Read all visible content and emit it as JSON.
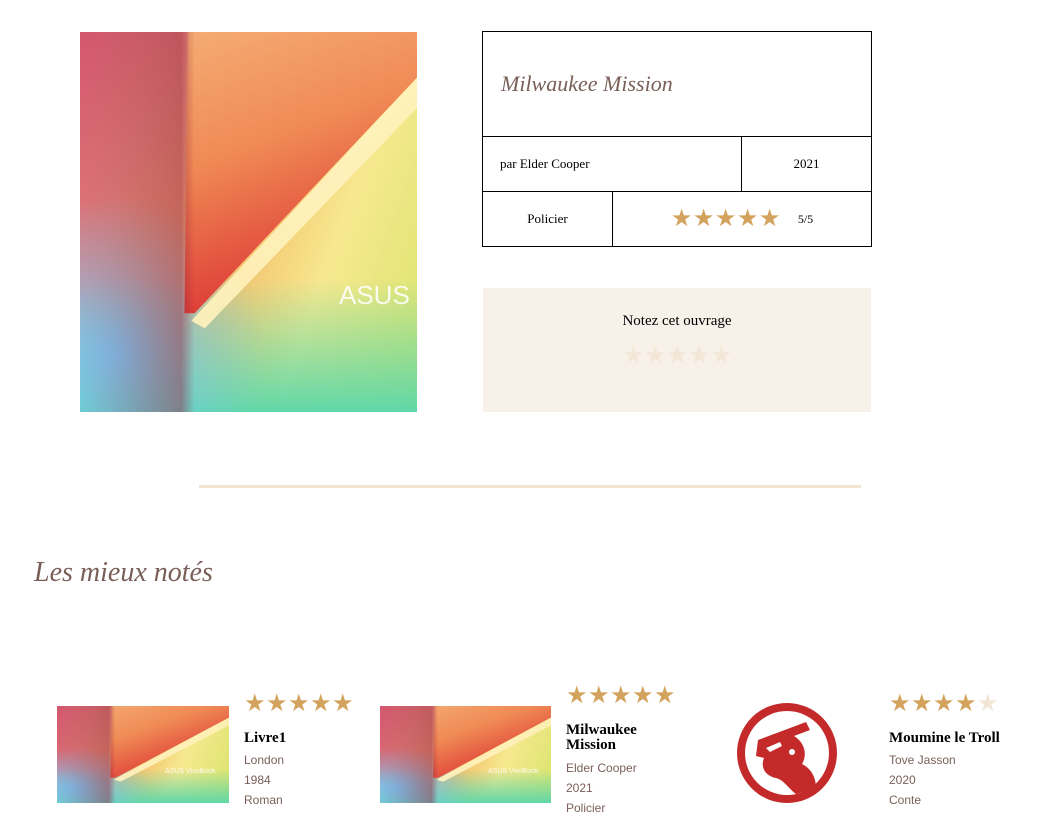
{
  "book": {
    "title": "Milwaukee Mission",
    "author_line": "par Elder Cooper",
    "year": "2021",
    "genre": "Policier",
    "rating": 5,
    "rating_text": "5/5",
    "cover_brand": "ASUS V"
  },
  "rate_prompt": {
    "label": "Notez cet ouvrage",
    "current_rating": 0
  },
  "top_rated": {
    "title": "Les mieux notés",
    "items": [
      {
        "title": "Livre1",
        "author": "London",
        "year": "1984",
        "genre": "Roman",
        "rating": 5,
        "cover": "asus-gradient",
        "cover_brand": "ASUS VivoBook"
      },
      {
        "title": "Milwaukee Mission",
        "author": "Elder Cooper",
        "year": "2021",
        "genre": "Policier",
        "rating": 5,
        "cover": "asus-gradient",
        "cover_brand": "ASUS VivoBook"
      },
      {
        "title": "Moumine le Troll",
        "author": "Tove Jasson",
        "year": "2020",
        "genre": "Conte",
        "rating": 4,
        "cover": "red-silhouette-logo"
      }
    ]
  },
  "colors": {
    "accent_gold": "#d3a35d",
    "title_brown": "#7a5f59",
    "rate_bg": "#f7f1ea",
    "divider": "#f2e4d2"
  }
}
